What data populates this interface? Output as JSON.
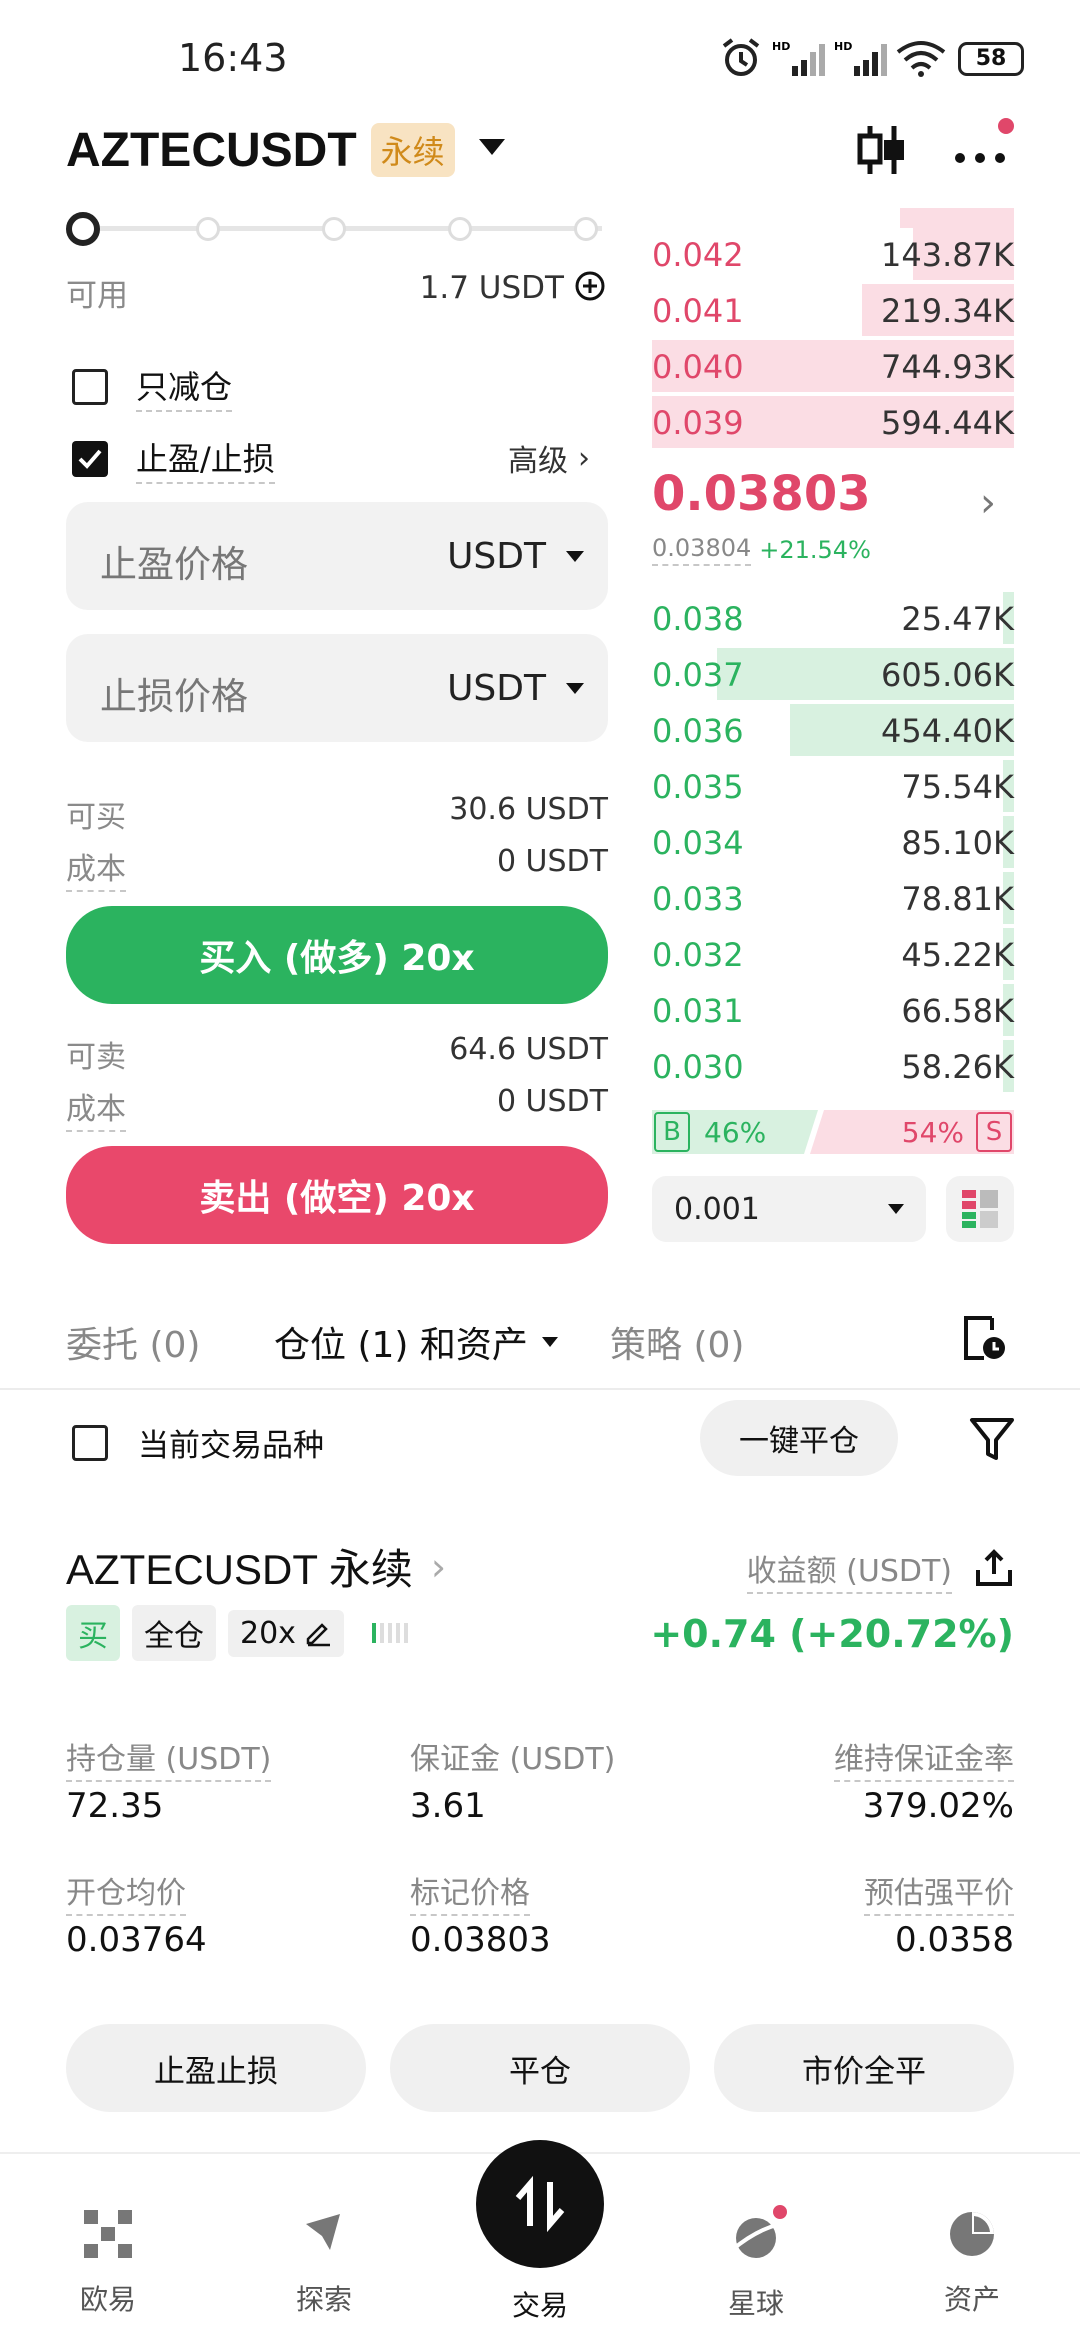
{
  "status_bar": {
    "time": "16:43",
    "battery": "58"
  },
  "header": {
    "symbol": "AZTECUSDT",
    "contract_tag": "永续"
  },
  "order_form": {
    "available_label": "可用",
    "available_value": "1.7 USDT",
    "reduce_only_label": "只减仓",
    "reduce_only_checked": false,
    "tpsl_label": "止盈/止损",
    "tpsl_checked": true,
    "advanced_label": "高级",
    "take_profit": {
      "placeholder": "止盈价格",
      "unit": "USDT"
    },
    "stop_loss": {
      "placeholder": "止损价格",
      "unit": "USDT"
    },
    "can_buy_label": "可买",
    "can_buy_value": "30.6 USDT",
    "cost_label": "成本",
    "buy_cost_value": "0 USDT",
    "buy_button": "买入 (做多) 20x",
    "can_sell_label": "可卖",
    "can_sell_value": "64.6 USDT",
    "sell_cost_value": "0 USDT",
    "sell_button": "卖出 (做空) 20x"
  },
  "orderbook": {
    "asks": [
      {
        "price": "0.042",
        "size": "143.87K",
        "depth": 0.28
      },
      {
        "price": "0.041",
        "size": "219.34K",
        "depth": 0.42
      },
      {
        "price": "0.040",
        "size": "744.93K",
        "depth": 1.0
      },
      {
        "price": "0.039",
        "size": "594.44K",
        "depth": 1.0
      }
    ],
    "last_price": "0.03803",
    "mark_price": "0.03804",
    "change": "+21.54%",
    "bids": [
      {
        "price": "0.038",
        "size": "25.47K",
        "depth": 0.03
      },
      {
        "price": "0.037",
        "size": "605.06K",
        "depth": 0.82
      },
      {
        "price": "0.036",
        "size": "454.40K",
        "depth": 0.62
      },
      {
        "price": "0.035",
        "size": "75.54K",
        "depth": 0.03
      },
      {
        "price": "0.034",
        "size": "85.10K",
        "depth": 0.03
      },
      {
        "price": "0.033",
        "size": "78.81K",
        "depth": 0.03
      },
      {
        "price": "0.032",
        "size": "45.22K",
        "depth": 0.03
      },
      {
        "price": "0.031",
        "size": "66.58K",
        "depth": 0.03
      },
      {
        "price": "0.030",
        "size": "58.26K",
        "depth": 0.03
      }
    ],
    "buy_tag": "B",
    "buy_pct": "46%",
    "sell_pct": "54%",
    "sell_tag": "S",
    "precision": "0.001"
  },
  "tabs": {
    "orders": "委托 (0)",
    "positions": "仓位 (1) 和资产",
    "strategy": "策略 (0)"
  },
  "filter": {
    "current_symbol_label": "当前交易品种",
    "close_all": "一键平仓"
  },
  "position": {
    "title": "AZTECUSDT 永续",
    "pnl_label": "收益额 (USDT)",
    "side": "买",
    "margin_mode": "全仓",
    "leverage": "20x",
    "pnl_value": "+0.74 (+20.72%)",
    "size_label": "持仓量 (USDT)",
    "size_value": "72.35",
    "margin_label": "保证金 (USDT)",
    "margin_value": "3.61",
    "mmr_label": "维持保证金率",
    "mmr_value": "379.02%",
    "entry_label": "开仓均价",
    "entry_value": "0.03764",
    "mark_label": "标记价格",
    "mark_value": "0.03803",
    "liq_label": "预估强平价",
    "liq_value": "0.0358",
    "btn_tpsl": "止盈止损",
    "btn_close": "平仓",
    "btn_market_close": "市价全平"
  },
  "bottom_nav": {
    "items": [
      "欧易",
      "探索",
      "交易",
      "星球",
      "资产"
    ]
  },
  "colors": {
    "buy": "#2bb35f",
    "sell": "#e0476a",
    "tag_bg": "#f8e3c2",
    "tag_fg": "#d08a1a"
  }
}
